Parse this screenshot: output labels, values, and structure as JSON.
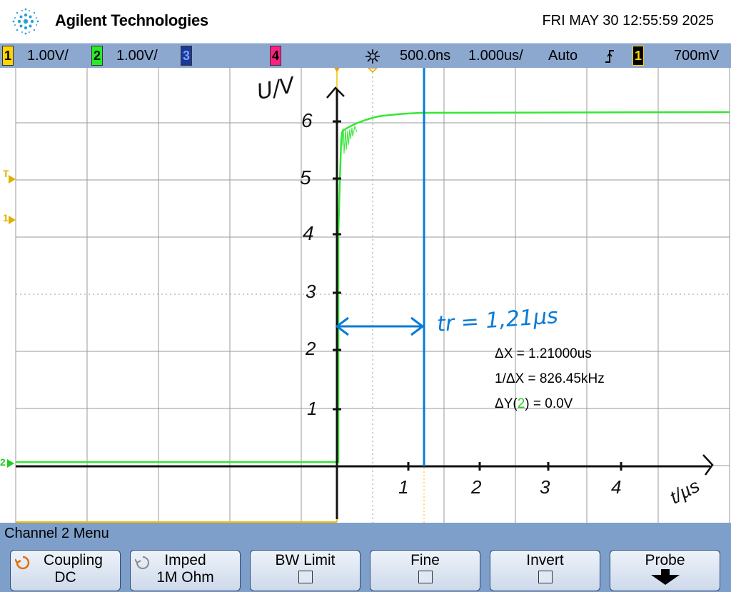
{
  "brand": {
    "name": "Agilent Technologies"
  },
  "datetime": "FRI MAY 30 12:55:59 2025",
  "status": {
    "ch1": {
      "num": "1",
      "scale": "1.00V/",
      "color": "#ffd400"
    },
    "ch2": {
      "num": "2",
      "scale": "1.00V/",
      "color": "#22ee22"
    },
    "ch3": {
      "num": "3",
      "color": "#3060ff"
    },
    "ch4": {
      "num": "4",
      "color": "#ff2080"
    },
    "time_pos": "500.0ns",
    "time_scale": "1.000us/",
    "trigger_mode": "Auto",
    "trigger_slope": "rising-edge-icon",
    "trigger_src": "1",
    "trigger_level": "700mV"
  },
  "measurements": {
    "dx": "ΔX = 1.21000us",
    "inv_dx": "1/ΔX = 826.45kHz",
    "dy_prefix": "ΔY(",
    "dy_ch": "2",
    "dy_suffix": ") = 0.0V"
  },
  "markers": {
    "trigger": "T",
    "ch1": "1",
    "ch2": "2"
  },
  "annotations": {
    "y_unit": "U/V",
    "x_unit": "t/µs",
    "rise_time": "tr = 1,21µs",
    "y_ticks": [
      "6",
      "5",
      "4",
      "3",
      "2",
      "1"
    ],
    "x_ticks": [
      "1",
      "2",
      "3",
      "4"
    ]
  },
  "menu": {
    "title": "Channel 2  Menu",
    "softkeys": [
      {
        "label": "Coupling",
        "value": "DC"
      },
      {
        "label": "Imped",
        "value": "1M Ohm"
      },
      {
        "label": "BW Limit",
        "value": ""
      },
      {
        "label": "Fine",
        "value": ""
      },
      {
        "label": "Invert",
        "value": ""
      },
      {
        "label": "Probe",
        "value": ""
      }
    ]
  },
  "colors": {
    "ch2": "#33e833",
    "cursor": "#0a7bd6",
    "ch1": "#f0c000",
    "grid": "#999999"
  }
}
